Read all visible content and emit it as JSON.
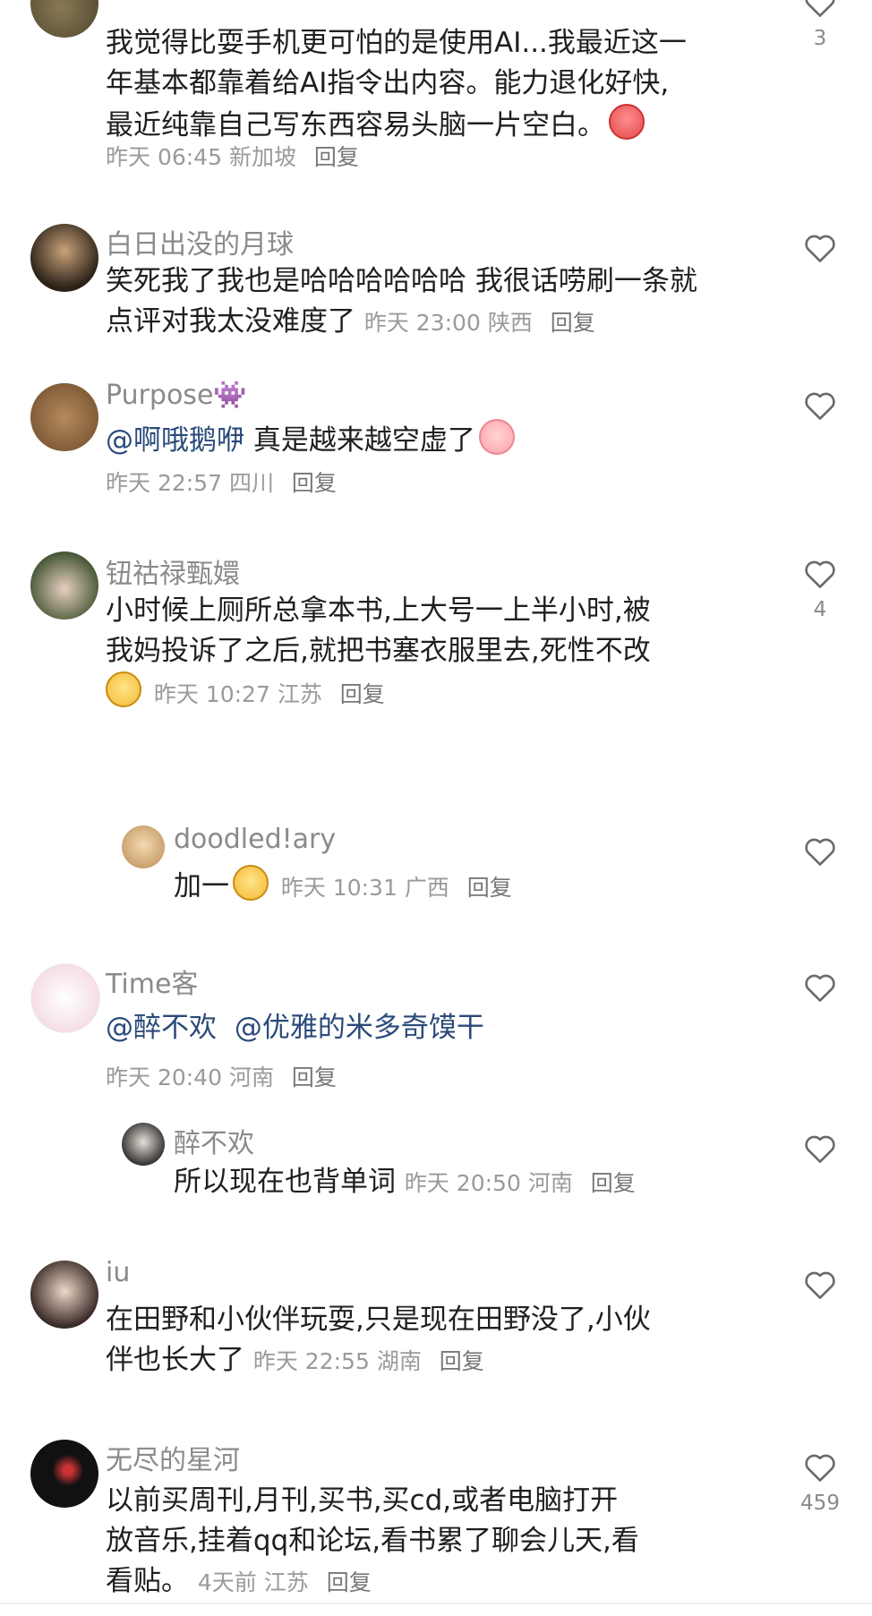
{
  "comments": [
    {
      "body_line1": "我觉得比耍手机更可怕的是使用AI...我最近这一",
      "body_line2": "年基本都靠着给AI指令出内容。能力退化好快,",
      "body_line3": "最近纯靠自己写东西容易头脑一片空白。",
      "emoji": "crying-face",
      "time": "昨天 06:45",
      "location": "新加坡",
      "reply": "回复",
      "likes": "3"
    },
    {
      "user": "白日出没的月球",
      "body_line1": "笑死我了我也是哈哈哈哈哈哈 我很话唠刷一条就",
      "body_line2": "点评对我太没难度了",
      "time": "昨天 23:00",
      "location": "陕西",
      "reply": "回复"
    },
    {
      "user": "Purpose",
      "user_emoji": "👾",
      "mention": "@啊哦鹅咿",
      "body": "真是越来越空虚了",
      "emoji": "peach-face",
      "time": "昨天 22:57",
      "location": "四川",
      "reply": "回复"
    },
    {
      "user": "钮祜禄甄嬛",
      "body_line1": "小时候上厕所总拿本书,上大号一上半小时,被",
      "body_line2": "我妈投诉了之后,就把书塞衣服里去,死性不改",
      "emoji": "dog-face",
      "time": "昨天 10:27",
      "location": "江苏",
      "reply": "回复",
      "likes": "4"
    },
    {
      "user": "doodled!ary",
      "body": "加一",
      "emoji": "dog-face",
      "time": "昨天 10:31",
      "location": "广西",
      "reply": "回复"
    },
    {
      "user": "Time客",
      "mention1": "@醉不欢",
      "mention2": "@优雅的米多奇馍干",
      "time": "昨天 20:40",
      "location": "河南",
      "reply": "回复"
    },
    {
      "user": "醉不欢",
      "body": "所以现在也背单词",
      "time": "昨天 20:50",
      "location": "河南",
      "reply": "回复"
    },
    {
      "user": "iu",
      "body_line1": "在田野和小伙伴玩耍,只是现在田野没了,小伙",
      "body_line2": "伴也长大了",
      "time": "昨天 22:55",
      "location": "湖南",
      "reply": "回复"
    },
    {
      "user": "无尽的星河",
      "body_line1": "以前买周刊,月刊,买书,买cd,或者电脑打开",
      "body_line2": "放音乐,挂着qq和论坛,看书累了聊会儿天,看",
      "body_line3": "看贴。",
      "time": "4天前",
      "location": "江苏",
      "reply": "回复",
      "likes": "459"
    }
  ],
  "colors": {
    "text": "#1f1f1f",
    "meta": "#9a9a9a",
    "mention": "#2a4a7a",
    "heart": "#6a6a6a"
  }
}
